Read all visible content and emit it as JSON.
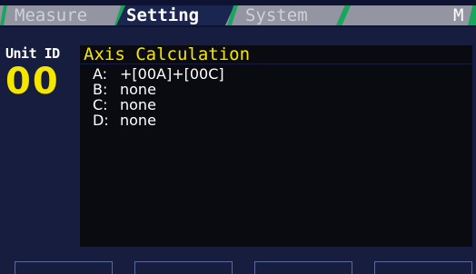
{
  "tabs": {
    "measure": "Measure",
    "setting": "Setting",
    "system": "System",
    "mode": "M"
  },
  "unit": {
    "label": "Unit ID",
    "value": "00"
  },
  "panel": {
    "title": "Axis Calculation",
    "rows": [
      {
        "key": "A:",
        "value": "+[00A]+[00C]"
      },
      {
        "key": "B:",
        "value": "none"
      },
      {
        "key": "C:",
        "value": "none"
      },
      {
        "key": "D:",
        "value": "none"
      }
    ]
  },
  "colors": {
    "background": "#171d3e",
    "panel": "#0a0b10",
    "accent_yellow": "#f5e600",
    "tab_separator_green": "#18a55c",
    "tab_strip_gray": "#9396a2"
  }
}
